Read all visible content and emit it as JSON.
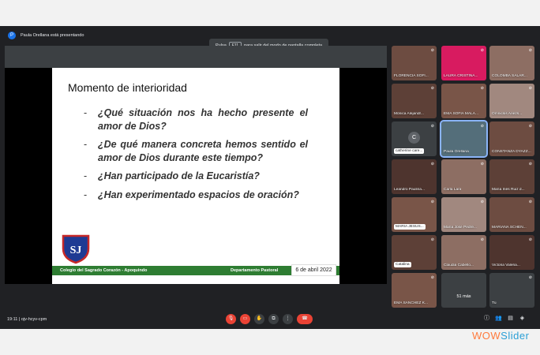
{
  "topbar": {
    "presenting_text": "Paula Orellana está presentando",
    "presenter_icon": "P"
  },
  "fullscreen_hint": {
    "pre": "Pulsa",
    "key": "F11",
    "post": "para salir del modo de pantalla completa"
  },
  "slide": {
    "title": "Momento de interioridad",
    "bullets": [
      "¿Qué situación nos ha hecho presente el amor de Dios?",
      "¿De qué manera concreta hemos sentido el amor de Dios durante este tiempo?",
      "¿Han participado de la Eucaristía?",
      "¿Han experimentado espacios de oración?"
    ],
    "bullet_markers": [
      "-",
      "-",
      "-",
      "-"
    ],
    "footer_school": "Colegio del Sagrado Corazón - Apoquindo",
    "footer_dept": "Departamento Pastoral",
    "date": "6 de abril 2022",
    "logo_letters": "SJ"
  },
  "participants": [
    {
      "name": "FLORENCIA SOFI...",
      "color": "#6d4c41"
    },
    {
      "name": "LAURA CRISTINA...",
      "color": "#d81b60"
    },
    {
      "name": "COLOMBA SALAR...",
      "color": "#8d6e63"
    },
    {
      "name": "Mónica Alejandr...",
      "color": "#5d4037"
    },
    {
      "name": "EMA SOFIA MALA...",
      "color": "#795548"
    },
    {
      "name": "Omnicsis Ariezs...",
      "color": "#a1887f"
    },
    {
      "name": "catherine care...",
      "color": "#3c4043",
      "badge": true,
      "avatar": "C"
    },
    {
      "name": "Paula Orellana",
      "color": "#546e7a",
      "active": true
    },
    {
      "name": "CONSTANZA DYAZZ...",
      "color": "#6d4c41"
    },
    {
      "name": "Leandro Paulina...",
      "color": "#4e342e"
    },
    {
      "name": "Carla Lara",
      "color": "#8d6e63"
    },
    {
      "name": "María Inés Ruiz d...",
      "color": "#5d4037"
    },
    {
      "name": "MARIA JESUS...",
      "color": "#795548",
      "badge": true
    },
    {
      "name": "María José Pedre...",
      "color": "#a1887f"
    },
    {
      "name": "MARIANA SCHEN...",
      "color": "#6d4c41"
    },
    {
      "name": "Catalina",
      "color": "#5d4037",
      "badge": true
    },
    {
      "name": "Claudia Cabello...",
      "color": "#8d6e63"
    },
    {
      "name": "Victoria Valeria...",
      "color": "#4e342e"
    },
    {
      "name": "EMA SANCHEZ K...",
      "color": "#795548"
    },
    {
      "name": "51 más",
      "color": "#3c4043",
      "more": true
    },
    {
      "name": "Tú",
      "color": "#3c4043"
    }
  ],
  "bottombar": {
    "time": "19:11",
    "code": "ojv-hcyv-cpm",
    "separator": "|"
  },
  "watermark": {
    "part1": "WOW",
    "part2": "Slider"
  }
}
